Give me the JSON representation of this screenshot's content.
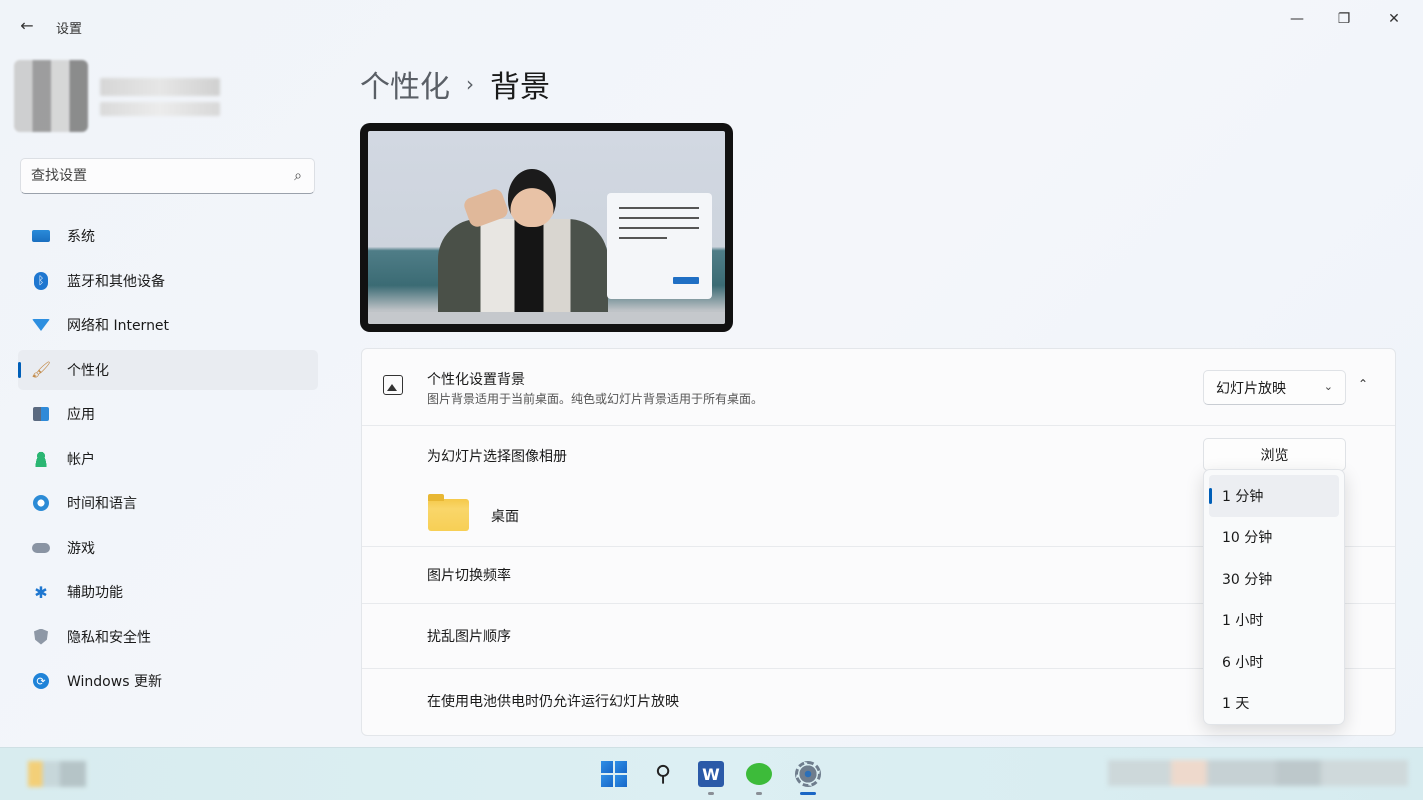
{
  "window": {
    "title": "设置",
    "back_icon": "←",
    "minimize_icon": "—",
    "maximize_icon": "❐",
    "close_icon": "✕"
  },
  "search": {
    "placeholder": "查找设置",
    "icon": "⌕"
  },
  "sidebar": {
    "items": [
      {
        "label": "系统",
        "icon": "system-icon"
      },
      {
        "label": "蓝牙和其他设备",
        "icon": "bluetooth-icon"
      },
      {
        "label": "网络和 Internet",
        "icon": "network-icon"
      },
      {
        "label": "个性化",
        "icon": "brush-icon",
        "active": true
      },
      {
        "label": "应用",
        "icon": "apps-icon"
      },
      {
        "label": "帐户",
        "icon": "account-icon"
      },
      {
        "label": "时间和语言",
        "icon": "time-language-icon"
      },
      {
        "label": "游戏",
        "icon": "gaming-icon"
      },
      {
        "label": "辅助功能",
        "icon": "accessibility-icon"
      },
      {
        "label": "隐私和安全性",
        "icon": "shield-icon"
      },
      {
        "label": "Windows 更新",
        "icon": "update-icon"
      }
    ]
  },
  "header": {
    "parent": "个性化",
    "separator": "›",
    "current": "背景"
  },
  "background_card": {
    "title": "个性化设置背景",
    "description": "图片背景适用于当前桌面。纯色或幻灯片背景适用于所有桌面。",
    "dropdown_value": "幻灯片放映",
    "dropdown_chevron": "⌄",
    "collapse_icon": "⌃",
    "album_label": "为幻灯片选择图像相册",
    "browse_label": "浏览",
    "folder_label": "桌面",
    "frequency_label": "图片切换频率",
    "shuffle_label": "扰乱图片顺序",
    "battery_label": "在使用电池供电时仍允许运行幻灯片放映"
  },
  "frequency_menu": {
    "options": [
      "1 分钟",
      "10 分钟",
      "30 分钟",
      "1 小时",
      "6 小时",
      "1 天"
    ],
    "selected_index": 0
  },
  "colors": {
    "accent": "#005fb8"
  }
}
